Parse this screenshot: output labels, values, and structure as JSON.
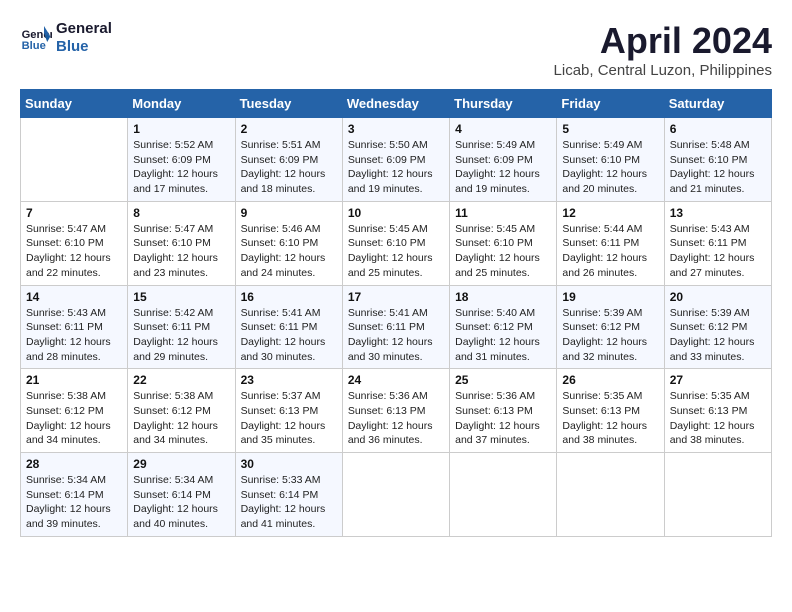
{
  "logo": {
    "line1": "General",
    "line2": "Blue"
  },
  "title": "April 2024",
  "location": "Licab, Central Luzon, Philippines",
  "weekdays": [
    "Sunday",
    "Monday",
    "Tuesday",
    "Wednesday",
    "Thursday",
    "Friday",
    "Saturday"
  ],
  "weeks": [
    [
      null,
      {
        "day": 1,
        "sunrise": "5:52 AM",
        "sunset": "6:09 PM",
        "daylight": "12 hours and 17 minutes."
      },
      {
        "day": 2,
        "sunrise": "5:51 AM",
        "sunset": "6:09 PM",
        "daylight": "12 hours and 18 minutes."
      },
      {
        "day": 3,
        "sunrise": "5:50 AM",
        "sunset": "6:09 PM",
        "daylight": "12 hours and 19 minutes."
      },
      {
        "day": 4,
        "sunrise": "5:49 AM",
        "sunset": "6:09 PM",
        "daylight": "12 hours and 19 minutes."
      },
      {
        "day": 5,
        "sunrise": "5:49 AM",
        "sunset": "6:10 PM",
        "daylight": "12 hours and 20 minutes."
      },
      {
        "day": 6,
        "sunrise": "5:48 AM",
        "sunset": "6:10 PM",
        "daylight": "12 hours and 21 minutes."
      }
    ],
    [
      {
        "day": 7,
        "sunrise": "5:47 AM",
        "sunset": "6:10 PM",
        "daylight": "12 hours and 22 minutes."
      },
      {
        "day": 8,
        "sunrise": "5:47 AM",
        "sunset": "6:10 PM",
        "daylight": "12 hours and 23 minutes."
      },
      {
        "day": 9,
        "sunrise": "5:46 AM",
        "sunset": "6:10 PM",
        "daylight": "12 hours and 24 minutes."
      },
      {
        "day": 10,
        "sunrise": "5:45 AM",
        "sunset": "6:10 PM",
        "daylight": "12 hours and 25 minutes."
      },
      {
        "day": 11,
        "sunrise": "5:45 AM",
        "sunset": "6:10 PM",
        "daylight": "12 hours and 25 minutes."
      },
      {
        "day": 12,
        "sunrise": "5:44 AM",
        "sunset": "6:11 PM",
        "daylight": "12 hours and 26 minutes."
      },
      {
        "day": 13,
        "sunrise": "5:43 AM",
        "sunset": "6:11 PM",
        "daylight": "12 hours and 27 minutes."
      }
    ],
    [
      {
        "day": 14,
        "sunrise": "5:43 AM",
        "sunset": "6:11 PM",
        "daylight": "12 hours and 28 minutes."
      },
      {
        "day": 15,
        "sunrise": "5:42 AM",
        "sunset": "6:11 PM",
        "daylight": "12 hours and 29 minutes."
      },
      {
        "day": 16,
        "sunrise": "5:41 AM",
        "sunset": "6:11 PM",
        "daylight": "12 hours and 30 minutes."
      },
      {
        "day": 17,
        "sunrise": "5:41 AM",
        "sunset": "6:11 PM",
        "daylight": "12 hours and 30 minutes."
      },
      {
        "day": 18,
        "sunrise": "5:40 AM",
        "sunset": "6:12 PM",
        "daylight": "12 hours and 31 minutes."
      },
      {
        "day": 19,
        "sunrise": "5:39 AM",
        "sunset": "6:12 PM",
        "daylight": "12 hours and 32 minutes."
      },
      {
        "day": 20,
        "sunrise": "5:39 AM",
        "sunset": "6:12 PM",
        "daylight": "12 hours and 33 minutes."
      }
    ],
    [
      {
        "day": 21,
        "sunrise": "5:38 AM",
        "sunset": "6:12 PM",
        "daylight": "12 hours and 34 minutes."
      },
      {
        "day": 22,
        "sunrise": "5:38 AM",
        "sunset": "6:12 PM",
        "daylight": "12 hours and 34 minutes."
      },
      {
        "day": 23,
        "sunrise": "5:37 AM",
        "sunset": "6:13 PM",
        "daylight": "12 hours and 35 minutes."
      },
      {
        "day": 24,
        "sunrise": "5:36 AM",
        "sunset": "6:13 PM",
        "daylight": "12 hours and 36 minutes."
      },
      {
        "day": 25,
        "sunrise": "5:36 AM",
        "sunset": "6:13 PM",
        "daylight": "12 hours and 37 minutes."
      },
      {
        "day": 26,
        "sunrise": "5:35 AM",
        "sunset": "6:13 PM",
        "daylight": "12 hours and 38 minutes."
      },
      {
        "day": 27,
        "sunrise": "5:35 AM",
        "sunset": "6:13 PM",
        "daylight": "12 hours and 38 minutes."
      }
    ],
    [
      {
        "day": 28,
        "sunrise": "5:34 AM",
        "sunset": "6:14 PM",
        "daylight": "12 hours and 39 minutes."
      },
      {
        "day": 29,
        "sunrise": "5:34 AM",
        "sunset": "6:14 PM",
        "daylight": "12 hours and 40 minutes."
      },
      {
        "day": 30,
        "sunrise": "5:33 AM",
        "sunset": "6:14 PM",
        "daylight": "12 hours and 41 minutes."
      },
      null,
      null,
      null,
      null
    ]
  ]
}
